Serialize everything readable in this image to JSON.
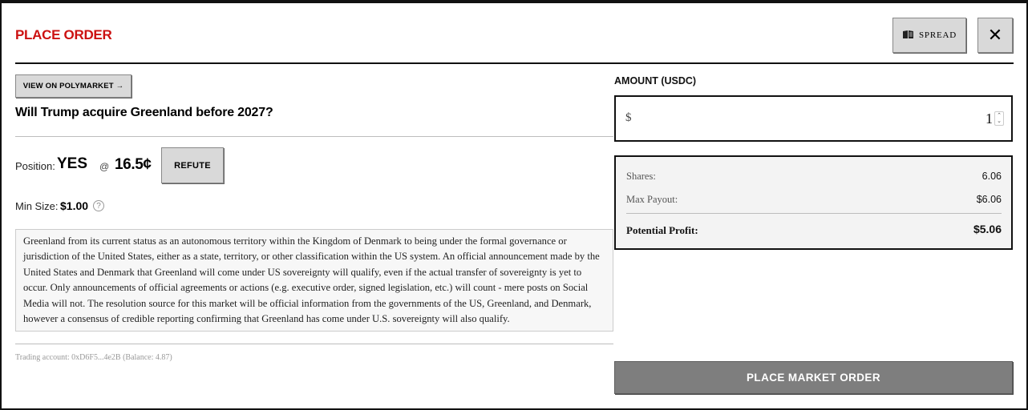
{
  "header": {
    "title": "PLACE ORDER",
    "spread_label": "SPREAD",
    "spread_icon": "book-icon",
    "close_icon": "close-icon",
    "close_glyph": "✕"
  },
  "market": {
    "polymarket_button": "VIEW ON POLYMARKET →",
    "question": "Will Trump acquire Greenland before 2027?",
    "position_label": "Position:",
    "position_value": "YES",
    "at": "@",
    "price": "16.5¢",
    "refute_label": "REFUTE",
    "min_size_label": "Min Size:",
    "min_size_value": "$1.00",
    "help_glyph": "?",
    "description": "Greenland from its current status as an autonomous territory within the Kingdom of Denmark to being under the formal governance or jurisdiction of the United States, either as a state, territory, or other classification within the US system. An official announcement made by the United States and Denmark that Greenland will come under US sovereignty will qualify, even if the actual transfer of sovereignty is yet to occur. Only announcements of official agreements or actions (e.g. executive order, signed legislation, etc.) will count - mere posts on Social Media will not. The resolution source for this market will be official information from the governments of the US, Greenland, and Denmark, however a consensus of credible reporting confirming that Greenland has come under U.S. sovereignty will also qualify.",
    "account": "Trading account: 0xD6F5...4e2B (Balance: 4.87)"
  },
  "order": {
    "amount_label": "AMOUNT (USDC)",
    "currency_symbol": "$",
    "amount_value": "1",
    "spinner_up": "⌃",
    "spinner_down": "⌄",
    "shares_label": "Shares:",
    "shares_value": "6.06",
    "max_payout_label": "Max Payout:",
    "max_payout_value": "$6.06",
    "profit_label": "Potential Profit:",
    "profit_value": "$5.06",
    "submit_label": "PLACE MARKET ORDER"
  },
  "colors": {
    "title_red": "#cc1111",
    "button_gray": "#d9d9d9",
    "submit_gray": "#7e7e7e"
  }
}
